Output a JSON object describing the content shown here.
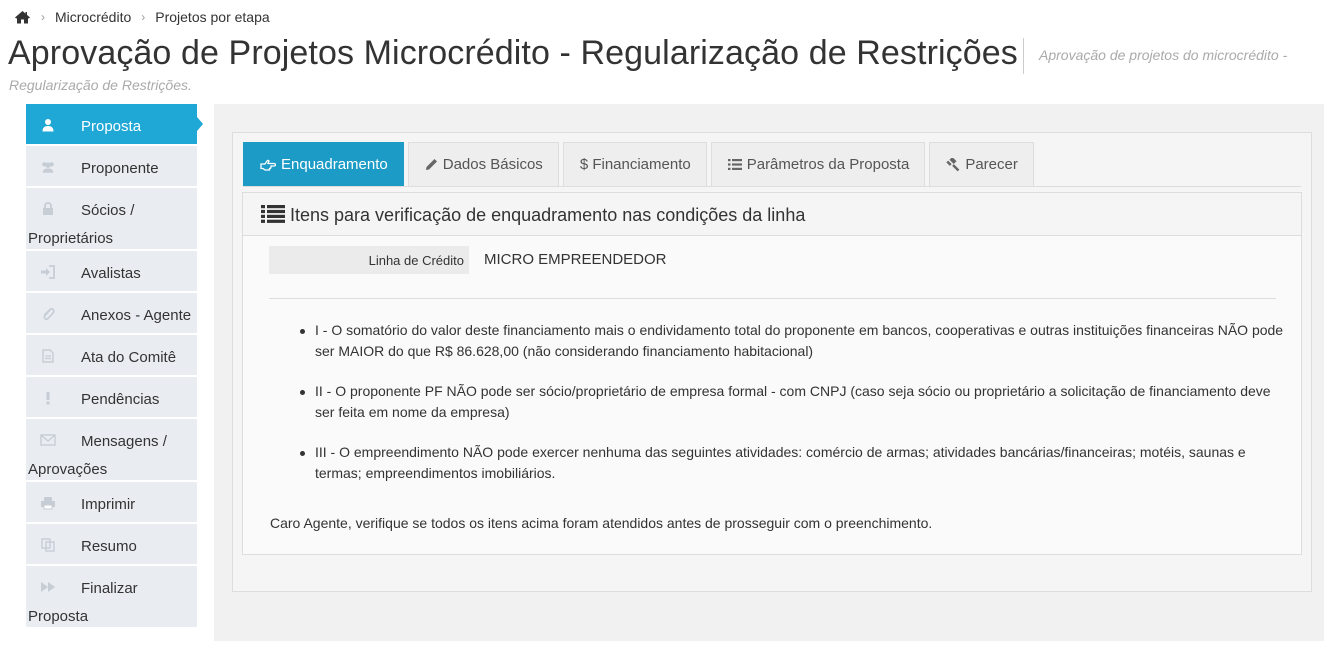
{
  "breadcrumb": {
    "items": [
      "Microcrédito",
      "Projetos por etapa"
    ]
  },
  "header": {
    "title": "Aprovação de Projetos Microcrédito - Regularização de Restrições",
    "subtitle_line1": "Aprovação de projetos do microcrédito -",
    "subtitle_line2": "Regularização de Restrições."
  },
  "sidebar": {
    "items": [
      {
        "label": "Proposta",
        "label2": "",
        "icon": "user-icon",
        "active": true
      },
      {
        "label": "Proponente",
        "label2": "",
        "icon": "users-icon"
      },
      {
        "label": "Sócios /",
        "label2": "Proprietários",
        "icon": "lock-icon"
      },
      {
        "label": "Avalistas",
        "icon": "sign-in-icon"
      },
      {
        "label": "Anexos - Agente",
        "icon": "paperclip-icon"
      },
      {
        "label": "Ata do Comitê",
        "icon": "document-icon"
      },
      {
        "label": "Pendências",
        "icon": "exclamation-icon"
      },
      {
        "label": "Mensagens /",
        "label2": "Aprovações",
        "icon": "envelope-icon"
      },
      {
        "label": "Imprimir",
        "icon": "print-icon"
      },
      {
        "label": "Resumo",
        "icon": "copy-icon"
      },
      {
        "label": "Finalizar",
        "label2": "Proposta",
        "icon": "fast-forward-icon"
      }
    ]
  },
  "tabs": [
    {
      "label": "Enquadramento",
      "icon": "hand-point-icon",
      "active": true
    },
    {
      "label": "Dados Básicos",
      "icon": "pencil-icon"
    },
    {
      "label": "$ Financiamento",
      "icon": "dollar-icon"
    },
    {
      "label": "Parâmetros da Proposta",
      "icon": "list-icon"
    },
    {
      "label": "Parecer",
      "icon": "gavel-icon"
    }
  ],
  "content": {
    "header": "Itens para verificação de enquadramento nas condições da linha",
    "credit_line_label": "Linha de Crédito",
    "credit_line_value": "MICRO EMPREENDEDOR",
    "items": [
      "I - O somatório do valor deste financiamento mais o endividamento total do proponente em bancos, cooperativas e outras instituições financeiras NÃO pode ser MAIOR do que R$ 86.628,00 (não considerando financiamento habitacional)",
      "II - O proponente PF NÃO pode ser sócio/proprietário de empresa formal - com CNPJ (caso seja sócio ou proprietário a solicitação de financiamento deve ser feita em nome da empresa)",
      "III - O empreendimento NÃO pode exercer nenhuma das seguintes atividades: comércio de armas; atividades bancárias/financeiras; motéis, saunas e termas; empreendimentos imobiliários."
    ],
    "footer_note": "Caro Agente, verifique se todos os itens acima foram atendidos antes de prosseguir com o preenchimento."
  },
  "colors": {
    "accent": "#1c9bc6",
    "sidebar_active": "#1fa7d6",
    "sidebar_bg": "#e9edf2"
  }
}
